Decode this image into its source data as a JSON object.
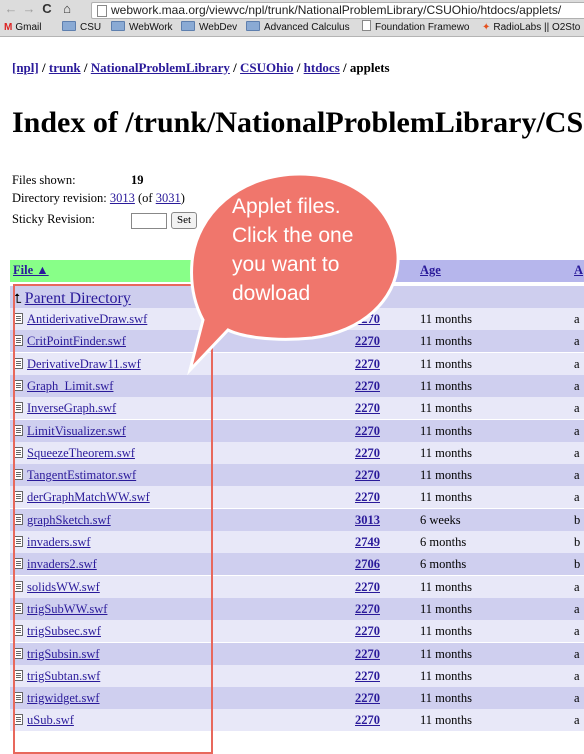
{
  "browser": {
    "url": "webwork.maa.org/viewvc/npl/trunk/NationalProblemLibrary/CSUOhio/htdocs/applets/",
    "bookmarks": [
      "Gmail",
      "CSU",
      "WebWork",
      "WebDev",
      "Advanced Calculus",
      "Foundation Framewo",
      "RadioLabs || O2Sto"
    ]
  },
  "breadcrumb": {
    "items": [
      "[npl]",
      "trunk",
      "NationalProblemLibrary",
      "CSUOhio",
      "htdocs"
    ],
    "separator": " / ",
    "current": "applets"
  },
  "title": "Index of /trunk/NationalProblemLibrary/CS",
  "info": {
    "files_label": "Files shown:",
    "files_value": "19",
    "dir_label": "Directory revision:",
    "dir_rev": "3013",
    "dir_of_prefix": " (of ",
    "dir_of_rev": "3031",
    "dir_of_suffix": ")",
    "sticky_label": "Sticky Revision:",
    "set_button": "Set"
  },
  "table": {
    "headers": {
      "file": "File ▲",
      "age": "Age",
      "author": "A"
    },
    "parent": "Parent Directory",
    "rows": [
      {
        "name": "AntiderivativeDraw.swf",
        "rev": "2270",
        "age": "11 months",
        "author": "a"
      },
      {
        "name": "CritPointFinder.swf",
        "rev": "2270",
        "age": "11 months",
        "author": "a"
      },
      {
        "name": "DerivativeDraw11.swf",
        "rev": "2270",
        "age": "11 months",
        "author": "a"
      },
      {
        "name": "Graph_Limit.swf",
        "rev": "2270",
        "age": "11 months",
        "author": "a"
      },
      {
        "name": "InverseGraph.swf",
        "rev": "2270",
        "age": "11 months",
        "author": "a"
      },
      {
        "name": "LimitVisualizer.swf",
        "rev": "2270",
        "age": "11 months",
        "author": "a"
      },
      {
        "name": "SqueezeTheorem.swf",
        "rev": "2270",
        "age": "11 months",
        "author": "a"
      },
      {
        "name": "TangentEstimator.swf",
        "rev": "2270",
        "age": "11 months",
        "author": "a"
      },
      {
        "name": "derGraphMatchWW.swf",
        "rev": "2270",
        "age": "11 months",
        "author": "a"
      },
      {
        "name": "graphSketch.swf",
        "rev": "3013",
        "age": "6 weeks",
        "author": "b"
      },
      {
        "name": "invaders.swf",
        "rev": "2749",
        "age": "6 months",
        "author": "b"
      },
      {
        "name": "invaders2.swf",
        "rev": "2706",
        "age": "6 months",
        "author": "b"
      },
      {
        "name": "solidsWW.swf",
        "rev": "2270",
        "age": "11 months",
        "author": "a"
      },
      {
        "name": "trigSubWW.swf",
        "rev": "2270",
        "age": "11 months",
        "author": "a"
      },
      {
        "name": "trigSubsec.swf",
        "rev": "2270",
        "age": "11 months",
        "author": "a"
      },
      {
        "name": "trigSubsin.swf",
        "rev": "2270",
        "age": "11 months",
        "author": "a"
      },
      {
        "name": "trigSubtan.swf",
        "rev": "2270",
        "age": "11 months",
        "author": "a"
      },
      {
        "name": "trigwidget.swf",
        "rev": "2270",
        "age": "11 months",
        "author": "a"
      },
      {
        "name": "uSub.swf",
        "rev": "2270",
        "age": "11 months",
        "author": "a"
      }
    ]
  },
  "annotation": {
    "lines": [
      "Applet files.",
      "Click the one",
      "you want to",
      "dowload"
    ]
  },
  "colors": {
    "link": "#2a1a9a",
    "header_file_bg": "#88ff88",
    "header_bg": "#b6b6ec",
    "row_odd": "#cfcfef",
    "row_even": "#e8e8f8",
    "callout_fill": "#f0766c",
    "callout_stroke": "#ffffff",
    "highlight_stroke": "#e8685c"
  }
}
